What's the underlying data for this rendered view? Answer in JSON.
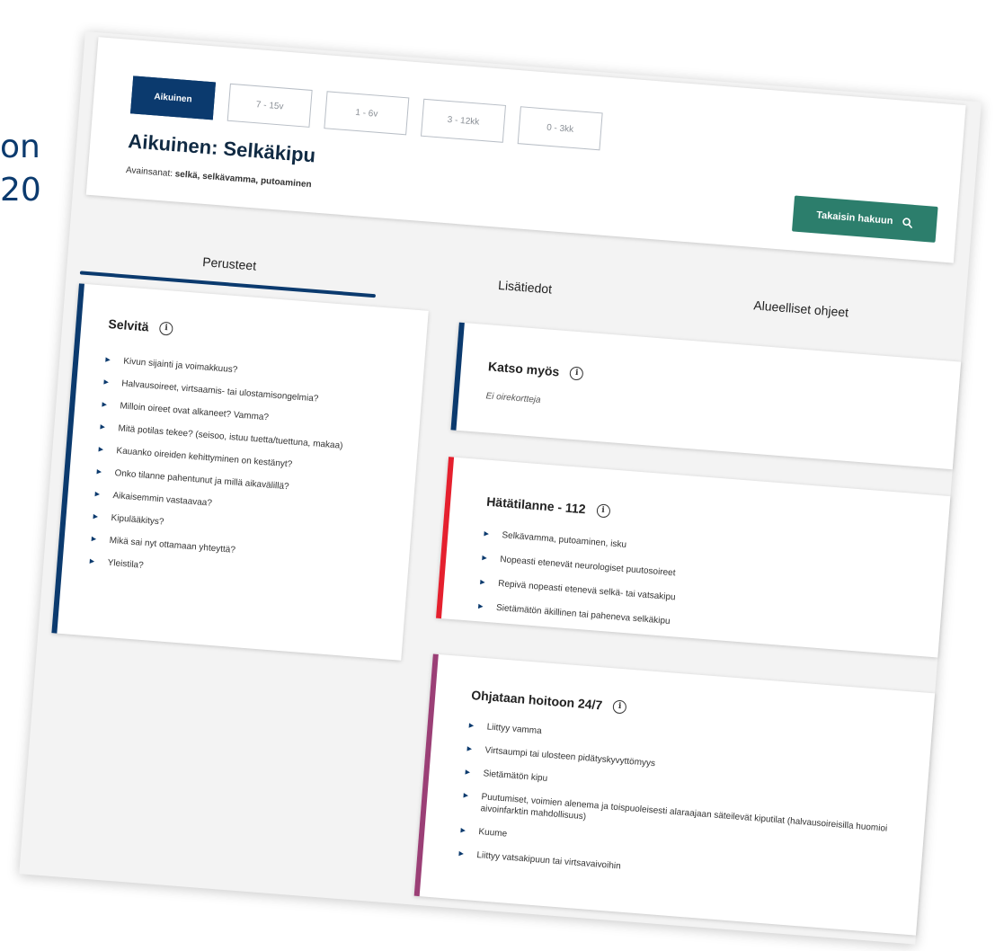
{
  "background": {
    "text_lines": [
      "on",
      "20"
    ],
    "color": "#0b3a6e"
  },
  "header": {
    "age_tabs": [
      {
        "label": "Aikuinen",
        "active": true
      },
      {
        "label": "7 - 15v",
        "active": false
      },
      {
        "label": "1 - 6v",
        "active": false
      },
      {
        "label": "3 - 12kk",
        "active": false
      },
      {
        "label": "0 - 3kk",
        "active": false
      }
    ],
    "title": "Aikuinen: Selkäkipu",
    "keywords_label": "Avainsanat:",
    "keywords": "selkä, selkävamma, putoaminen",
    "back_button_label": "Takaisin hakuun",
    "back_button_icon": "search-icon",
    "back_button_color": "#2c7e6c"
  },
  "tabs": [
    {
      "label": "Perusteet",
      "active": true
    },
    {
      "label": "Lisätiedot",
      "active": false
    },
    {
      "label": "Alueelliset ohjeet",
      "active": false
    }
  ],
  "cards": {
    "selvita": {
      "title": "Selvitä",
      "accent": "#0b3a6e",
      "items": [
        "Kivun sijainti ja voimakkuus?",
        "Halvausoireet, virtsaamis- tai ulostamisongelmia?",
        "Milloin oireet ovat alkaneet? Vamma?",
        "Mitä potilas tekee? (seisoo, istuu tuetta/tuettuna, makaa)",
        "Kauanko oireiden kehittyminen on kestänyt?",
        "Onko tilanne pahentunut ja millä aikavälillä?",
        "Aikaisemmin vastaavaa?",
        "Kipulääkitys?",
        "Mikä sai nyt ottamaan yhteyttä?",
        "Yleistila?"
      ]
    },
    "katso": {
      "title": "Katso myös",
      "accent": "#0b3a6e",
      "empty_text": "Ei oirekortteja"
    },
    "hatatilanne": {
      "title": "Hätätilanne - 112",
      "accent": "#e5202e",
      "items": [
        "Selkävamma, putoaminen, isku",
        "Nopeasti etenevät neurologiset puutosoireet",
        "Repivä nopeasti etenevä selkä- tai vatsakipu",
        "Sietämätön äkillinen tai paheneva selkäkipu"
      ]
    },
    "ohjataan": {
      "title": "Ohjataan hoitoon 24/7",
      "accent": "#9b3f76",
      "items": [
        "Liittyy vamma",
        "Virtsaumpi tai ulosteen pidätyskyvyttömyys",
        "Sietämätön kipu",
        "Puutumiset, voimien alenema ja toispuoleisesti alaraajaan säteilevät kiputilat (halvausoireisilla huomioi aivoinfarktin mahdollisuus)",
        "Kuume",
        "Liittyy vatsakipuun tai virtsavaivoihin"
      ]
    }
  }
}
